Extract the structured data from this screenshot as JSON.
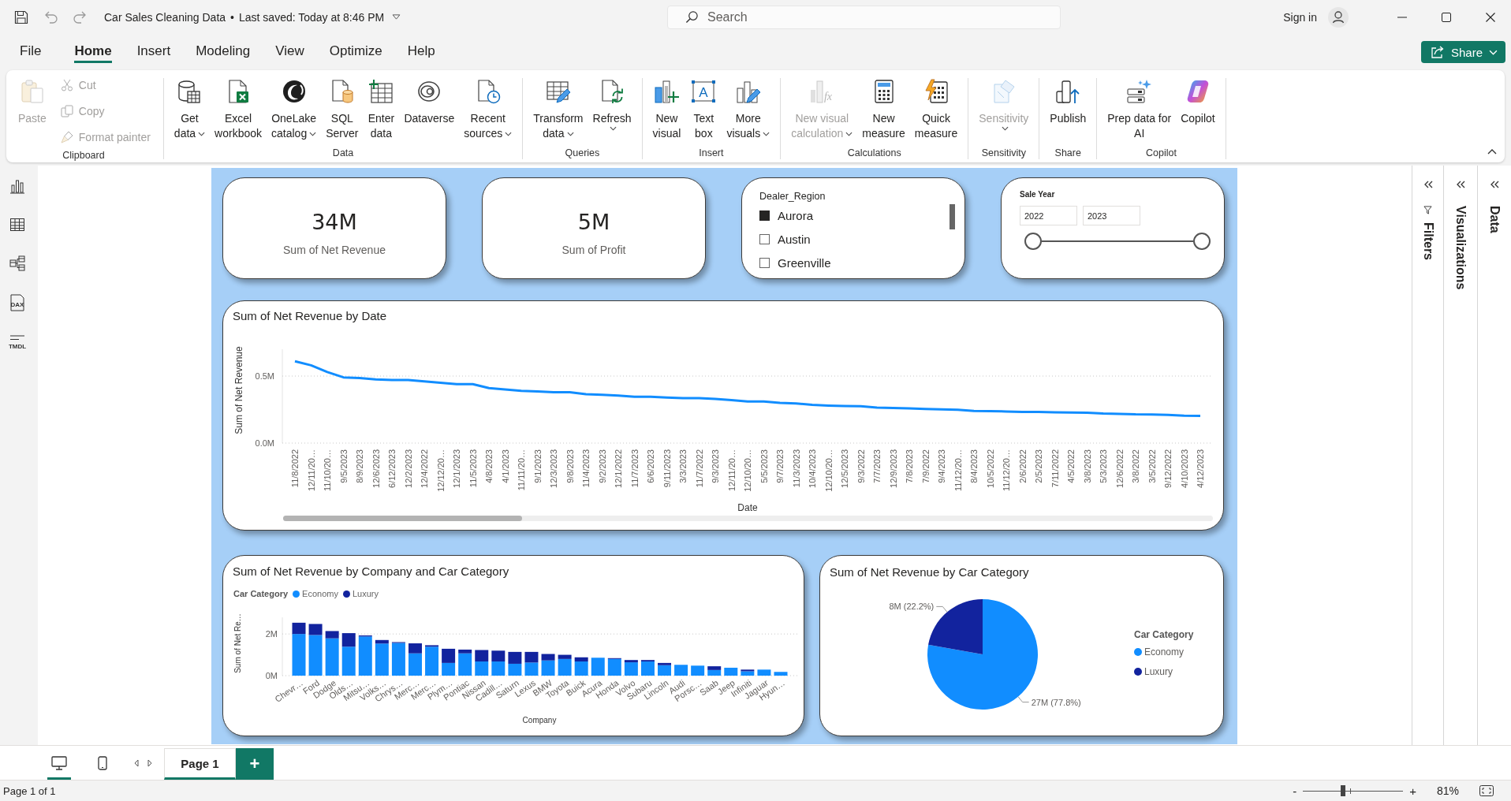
{
  "title_bar": {
    "file_name": "Car Sales Cleaning Data",
    "separator": "•",
    "last_saved": "Last saved: Today at 8:46 PM",
    "search": {
      "placeholder": "Search"
    },
    "sign_in": "Sign in"
  },
  "menu": {
    "tabs": [
      {
        "label": "File",
        "selected": false
      },
      {
        "label": "Home",
        "selected": true
      },
      {
        "label": "Insert",
        "selected": false
      },
      {
        "label": "Modeling",
        "selected": false
      },
      {
        "label": "View",
        "selected": false
      },
      {
        "label": "Optimize",
        "selected": false
      },
      {
        "label": "Help",
        "selected": false
      }
    ],
    "share_button": "Share"
  },
  "ribbon": {
    "groups": [
      {
        "label": "Clipboard",
        "buttons": [
          {
            "kind": "large",
            "lines": [
              "Paste"
            ],
            "dropdown": false,
            "disabled": true
          },
          {
            "kind": "small",
            "lines": [
              "Cut"
            ],
            "dropdown": false,
            "disabled": true
          },
          {
            "kind": "small",
            "lines": [
              "Copy"
            ],
            "dropdown": false,
            "disabled": true
          },
          {
            "kind": "small",
            "lines": [
              "Format painter"
            ],
            "dropdown": false,
            "disabled": true
          }
        ]
      },
      {
        "label": "Data",
        "buttons": [
          {
            "kind": "large",
            "lines": [
              "Get",
              "data"
            ],
            "dropdown": true,
            "disabled": false
          },
          {
            "kind": "large",
            "lines": [
              "Excel",
              "workbook"
            ],
            "dropdown": false,
            "disabled": false
          },
          {
            "kind": "large",
            "lines": [
              "OneLake",
              "catalog"
            ],
            "dropdown": true,
            "disabled": false
          },
          {
            "kind": "large",
            "lines": [
              "SQL",
              "Server"
            ],
            "dropdown": false,
            "disabled": false
          },
          {
            "kind": "large",
            "lines": [
              "Enter",
              "data"
            ],
            "dropdown": false,
            "disabled": false
          },
          {
            "kind": "large",
            "lines": [
              "Dataverse"
            ],
            "dropdown": false,
            "disabled": false
          },
          {
            "kind": "large",
            "lines": [
              "Recent",
              "sources"
            ],
            "dropdown": true,
            "disabled": false
          }
        ]
      },
      {
        "label": "Queries",
        "buttons": [
          {
            "kind": "large",
            "lines": [
              "Transform",
              "data"
            ],
            "dropdown": true,
            "disabled": false
          },
          {
            "kind": "large",
            "lines": [
              "Refresh"
            ],
            "dropdown": true,
            "disabled": false
          }
        ]
      },
      {
        "label": "Insert",
        "buttons": [
          {
            "kind": "large",
            "lines": [
              "New",
              "visual"
            ],
            "dropdown": false,
            "disabled": false
          },
          {
            "kind": "large",
            "lines": [
              "Text",
              "box"
            ],
            "glyph": "A",
            "dropdown": false,
            "disabled": false
          },
          {
            "kind": "large",
            "lines": [
              "More",
              "visuals"
            ],
            "dropdown": true,
            "disabled": false
          }
        ]
      },
      {
        "label": "Calculations",
        "buttons": [
          {
            "kind": "large",
            "lines": [
              "New visual",
              "calculation"
            ],
            "glyph": "fx",
            "dropdown": true,
            "disabled": true
          },
          {
            "kind": "large",
            "lines": [
              "New",
              "measure"
            ],
            "dropdown": false,
            "disabled": false
          },
          {
            "kind": "large",
            "lines": [
              "Quick",
              "measure"
            ],
            "dropdown": false,
            "disabled": false
          }
        ]
      },
      {
        "label": "Sensitivity",
        "buttons": [
          {
            "kind": "large",
            "lines": [
              "Sensitivity"
            ],
            "dropdown": true,
            "disabled": true
          }
        ]
      },
      {
        "label": "Share",
        "buttons": [
          {
            "kind": "large",
            "lines": [
              "Publish"
            ],
            "dropdown": false,
            "disabled": false
          }
        ]
      },
      {
        "label": "Copilot",
        "buttons": [
          {
            "kind": "large",
            "lines": [
              "Prep data for",
              "AI"
            ],
            "dropdown": false,
            "disabled": false
          },
          {
            "kind": "large",
            "lines": [
              "Copilot"
            ],
            "dropdown": false,
            "disabled": false
          }
        ]
      }
    ]
  },
  "sidebar": {
    "views": [
      {
        "kind": "report"
      },
      {
        "kind": "table"
      },
      {
        "kind": "model"
      },
      {
        "kind": "dax",
        "text": "DAX"
      },
      {
        "kind": "tmdl",
        "text": "TMDL"
      }
    ]
  },
  "canvas": {
    "cards": [
      {
        "value": "34M",
        "label": "Sum of Net Revenue"
      },
      {
        "value": "5M",
        "label": "Sum of Profit"
      }
    ],
    "region_slicer": {
      "title": "Dealer_Region",
      "items": [
        {
          "label": "Aurora",
          "checked": true
        },
        {
          "label": "Austin",
          "checked": false
        },
        {
          "label": "Greenville",
          "checked": false
        }
      ]
    },
    "year_slicer": {
      "title": "Sale Year",
      "from": "2022",
      "to": "2023",
      "level": 1
    },
    "line_chart": {
      "chart_data": [
        {
          "type": "line",
          "title": "Sum of Net Revenue by Date",
          "xlabel": "Date",
          "ylabel": "Sum of Net Revenue",
          "categories": [
            "11/8/2022",
            "12/11/20…",
            "11/10/20…",
            "9/5/2023",
            "8/9/2023",
            "12/6/2023",
            "6/12/2023",
            "12/2/2023",
            "12/4/2022",
            "12/12/20…",
            "12/1/2023",
            "11/5/2023",
            "4/8/2023",
            "4/1/2023",
            "11/11/20…",
            "9/1/2023",
            "12/3/2023",
            "9/8/2023",
            "11/4/2023",
            "9/2/2023",
            "12/1/2022",
            "11/7/2023",
            "6/6/2023",
            "9/11/2023",
            "3/3/2023",
            "11/7/2022",
            "9/3/2023",
            "12/11/20…",
            "12/10/20…",
            "5/5/2023",
            "9/7/2023",
            "11/3/2023",
            "10/4/2023",
            "12/10/20…",
            "12/5/2023",
            "9/3/2022",
            "7/7/2023",
            "12/9/2023",
            "7/8/2023",
            "7/9/2022",
            "9/4/2023",
            "11/12/20…",
            "8/4/2023",
            "10/5/2022",
            "11/12/20…",
            "2/6/2022",
            "2/5/2023",
            "7/11/2022",
            "4/5/2022",
            "3/8/2023",
            "5/3/2023",
            "12/6/2022",
            "3/8/2022",
            "3/5/2022",
            "9/12/2022",
            "4/10/2023",
            "4/12/2023"
          ],
          "values": [
            0.61,
            0.58,
            0.53,
            0.49,
            0.485,
            0.475,
            0.47,
            0.47,
            0.46,
            0.45,
            0.44,
            0.44,
            0.41,
            0.4,
            0.39,
            0.385,
            0.38,
            0.38,
            0.365,
            0.36,
            0.355,
            0.345,
            0.345,
            0.34,
            0.335,
            0.335,
            0.33,
            0.32,
            0.31,
            0.31,
            0.3,
            0.295,
            0.285,
            0.28,
            0.277,
            0.275,
            0.265,
            0.262,
            0.258,
            0.255,
            0.252,
            0.248,
            0.24,
            0.238,
            0.236,
            0.233,
            0.232,
            0.23,
            0.228,
            0.226,
            0.22,
            0.218,
            0.214,
            0.213,
            0.21,
            0.205,
            0.203
          ],
          "color": "#118dff",
          "yticks": [
            {
              "value": 0,
              "label": "0.0M"
            },
            {
              "value": 0.5,
              "label": "0.5M"
            }
          ],
          "ylim": [
            0,
            0.7
          ],
          "grid": true
        }
      ]
    },
    "bar_chart": {
      "chart_data": [
        {
          "type": "bar",
          "title": "Sum of Net Revenue by Company and Car Category",
          "xlabel": "Company",
          "ylabel": "Sum of Net Re…",
          "legend_title": "Car Category",
          "legend": "top",
          "stacked": true,
          "categories": [
            "Chevr…",
            "Ford",
            "Dodge",
            "Olds…",
            "Mitsu…",
            "Volks…",
            "Chrys…",
            "Merc…",
            "Merc…",
            "Plym…",
            "Pontiac",
            "Nissan",
            "Cadill…",
            "Saturn",
            "Lexus",
            "BMW",
            "Toyota",
            "Buick",
            "Acura",
            "Honda",
            "Volvo",
            "Subaru",
            "Lincoln",
            "Audi",
            "Porsc…",
            "Saab",
            "Jeep",
            "Infiniti",
            "Jaguar",
            "Hyun…"
          ],
          "series": [
            {
              "name": "Economy",
              "color": "#118dff",
              "values": [
                2.0,
                1.95,
                1.79,
                1.39,
                1.88,
                1.54,
                1.57,
                1.07,
                1.39,
                0.61,
                1.07,
                0.68,
                0.68,
                0.57,
                0.63,
                0.73,
                0.8,
                0.68,
                0.86,
                0.8,
                0.64,
                0.68,
                0.5,
                0.52,
                0.48,
                0.27,
                0.38,
                0.21,
                0.29,
                0.18
              ]
            },
            {
              "name": "Luxury",
              "color": "#12239e",
              "values": [
                0.54,
                0.53,
                0.35,
                0.65,
                0.05,
                0.17,
                0.04,
                0.48,
                0.07,
                0.68,
                0.18,
                0.55,
                0.52,
                0.57,
                0.51,
                0.31,
                0.2,
                0.2,
                0,
                0.04,
                0.11,
                0.07,
                0.11,
                0,
                0,
                0.18,
                0,
                0.08,
                0,
                0
              ]
            }
          ],
          "yticks": [
            {
              "value": 0,
              "label": "0M"
            },
            {
              "value": 2,
              "label": "2M"
            }
          ],
          "ylim": [
            0,
            2.8
          ],
          "grid": true
        }
      ]
    },
    "pie_chart": {
      "chart_data": [
        {
          "type": "pie",
          "title": "Sum of Net Revenue by Car Category",
          "legend_title": "Car Category",
          "legend": "right",
          "categories": [
            "Economy",
            "Luxury"
          ],
          "values": [
            77.8,
            22.2
          ],
          "colors": [
            "#118dff",
            "#12239e"
          ],
          "value_labels": [
            "27M (77.8%)",
            "8M (22.2%)"
          ]
        }
      ]
    }
  },
  "panes": [
    {
      "label": "Filters"
    },
    {
      "label": "Visualizations"
    },
    {
      "label": "Data"
    }
  ],
  "page_tabs": {
    "layouts": [
      {
        "selected": true
      },
      {
        "selected": false
      }
    ],
    "tabs": [
      {
        "label": "Page 1",
        "selected": true
      }
    ],
    "add": "+"
  },
  "status_bar": {
    "page_info": "Page 1 of 1",
    "zoom_out": "-",
    "zoom_in": "+",
    "zoom_slider": {
      "level": 0.4
    },
    "zoom": "81%"
  }
}
